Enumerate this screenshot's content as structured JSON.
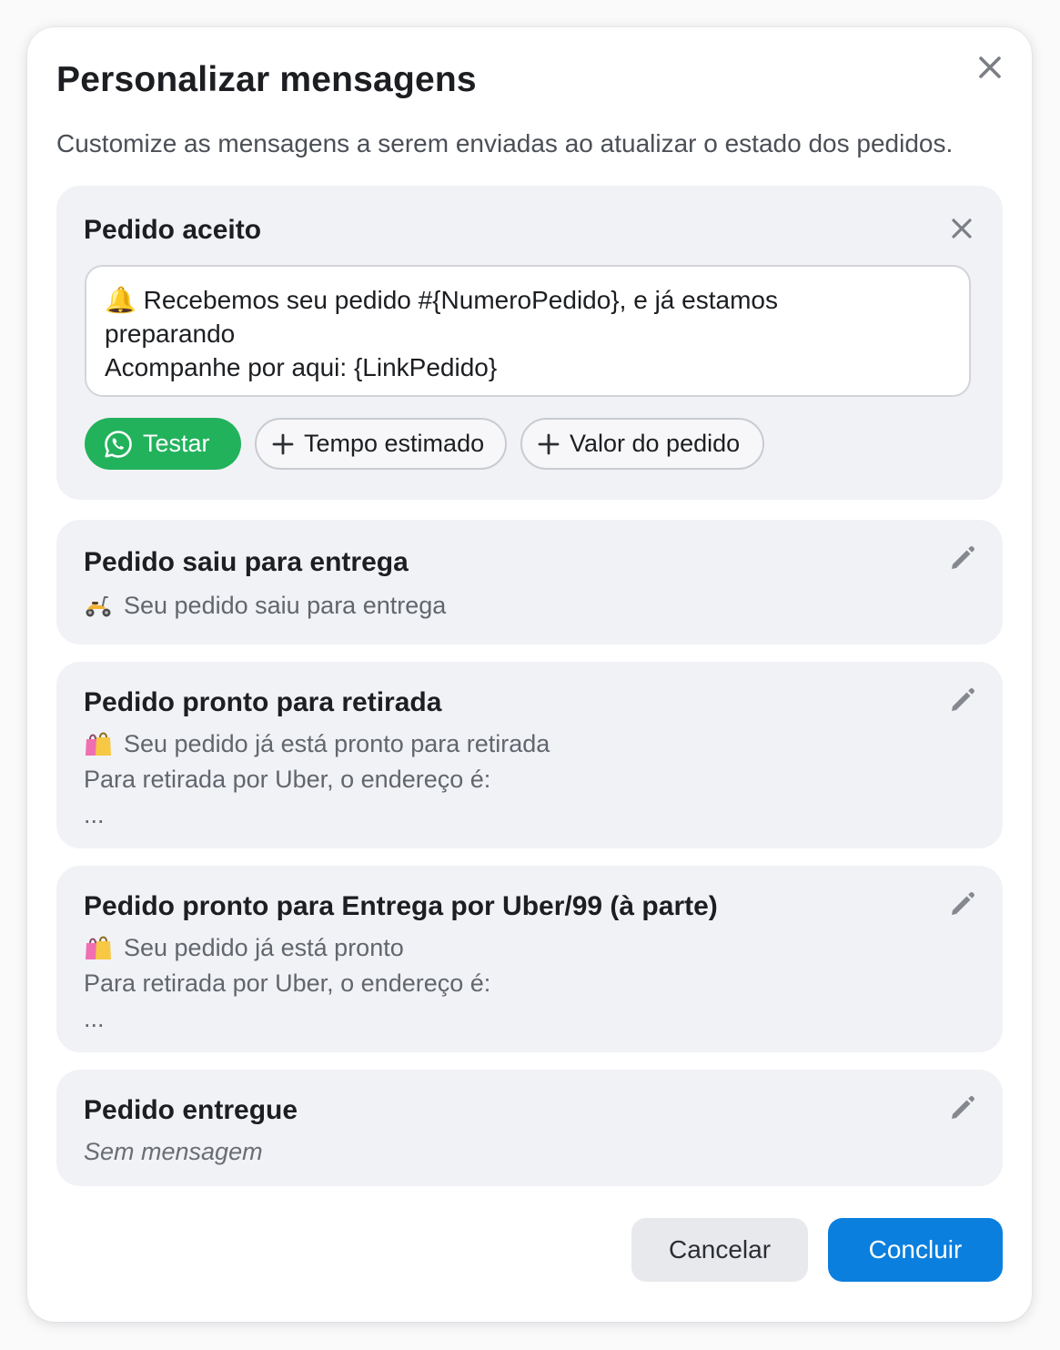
{
  "modal": {
    "title": "Personalizar mensagens",
    "subtitle": "Customize as mensagens a serem enviadas ao atualizar o estado dos pedidos."
  },
  "accepted": {
    "title": "Pedido aceito",
    "message_lines": [
      "🔔 Recebemos seu pedido #{NumeroPedido}, e já estamos",
      "preparando",
      "Acompanhe por aqui: {LinkPedido}"
    ],
    "test_label": "Testar",
    "estimated_time_label": "Tempo estimado",
    "order_value_label": "Valor do pedido"
  },
  "cards": [
    {
      "title": "Pedido saiu para entrega",
      "emoji_icon": "scooter-icon",
      "lines": [
        "Seu pedido saiu para entrega"
      ]
    },
    {
      "title": "Pedido pronto para retirada",
      "emoji_icon": "shopping-bags-icon",
      "lines": [
        "Seu pedido já está pronto para retirada",
        "Para retirada por Uber, o endereço é:",
        "..."
      ]
    },
    {
      "title": "Pedido pronto para Entrega por Uber/99 (à parte)",
      "emoji_icon": "shopping-bags-icon",
      "lines": [
        "Seu pedido já está pronto",
        "Para retirada por Uber, o endereço é:",
        "..."
      ]
    },
    {
      "title": "Pedido entregue",
      "lines": [
        "Sem mensagem"
      ]
    }
  ],
  "footer": {
    "cancel_label": "Cancelar",
    "confirm_label": "Concluir"
  },
  "colors": {
    "accent_blue": "#0a7fde",
    "whatsapp_green": "#22b25c",
    "card_background": "#f1f2f6"
  }
}
